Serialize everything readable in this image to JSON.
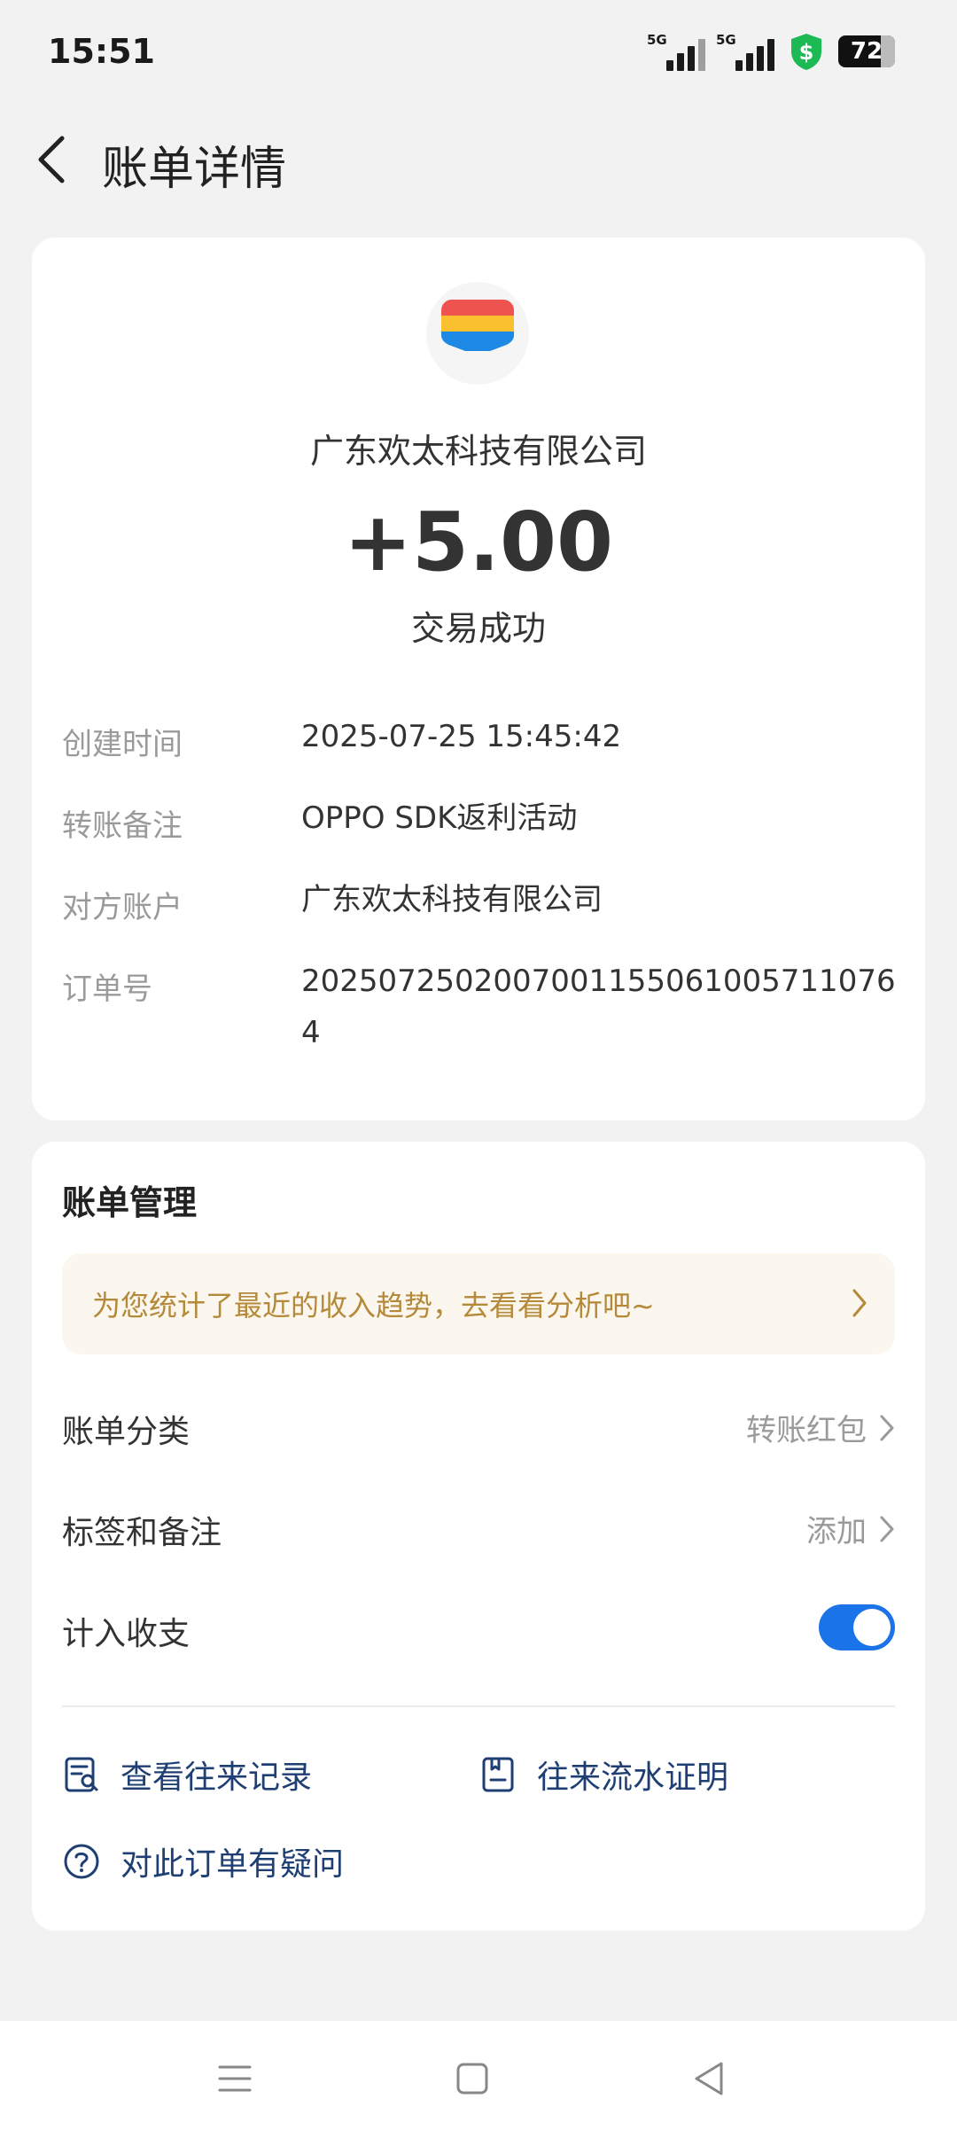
{
  "status_bar": {
    "time": "15:51",
    "signal1_label": "5G",
    "signal2_label": "5G",
    "battery": "72",
    "icons": [
      "signal-5g-icon",
      "signal-5g-icon",
      "security-shield-icon",
      "battery-icon"
    ]
  },
  "header": {
    "title": "账单详情",
    "back_icon": "chevron-left-icon"
  },
  "summary": {
    "merchant": "广东欢太科技有限公司",
    "amount": "+5.00",
    "status": "交易成功",
    "rows": [
      {
        "label": "创建时间",
        "value": "2025-07-25 15:45:42"
      },
      {
        "label": "转账备注",
        "value": "OPPO SDK返利活动"
      },
      {
        "label": "对方账户",
        "value": "广东欢太科技有限公司"
      },
      {
        "label": "订单号",
        "value": "20250725020070011550610057110764"
      }
    ]
  },
  "management": {
    "title": "账单管理",
    "banner_text": "为您统计了最近的收入趋势，去看看分析吧~",
    "category_label": "账单分类",
    "category_value": "转账红包",
    "tags_label": "标签和备注",
    "tags_value": "添加",
    "include_label": "计入收支",
    "include_enabled": true,
    "links": {
      "history": "查看往来记录",
      "proof": "往来流水证明",
      "question": "对此订单有疑问"
    }
  },
  "colors": {
    "accent": "#1a73e8",
    "banner_text": "#b48a3a",
    "link": "#1f3f73",
    "background": "#f2f2f2"
  }
}
